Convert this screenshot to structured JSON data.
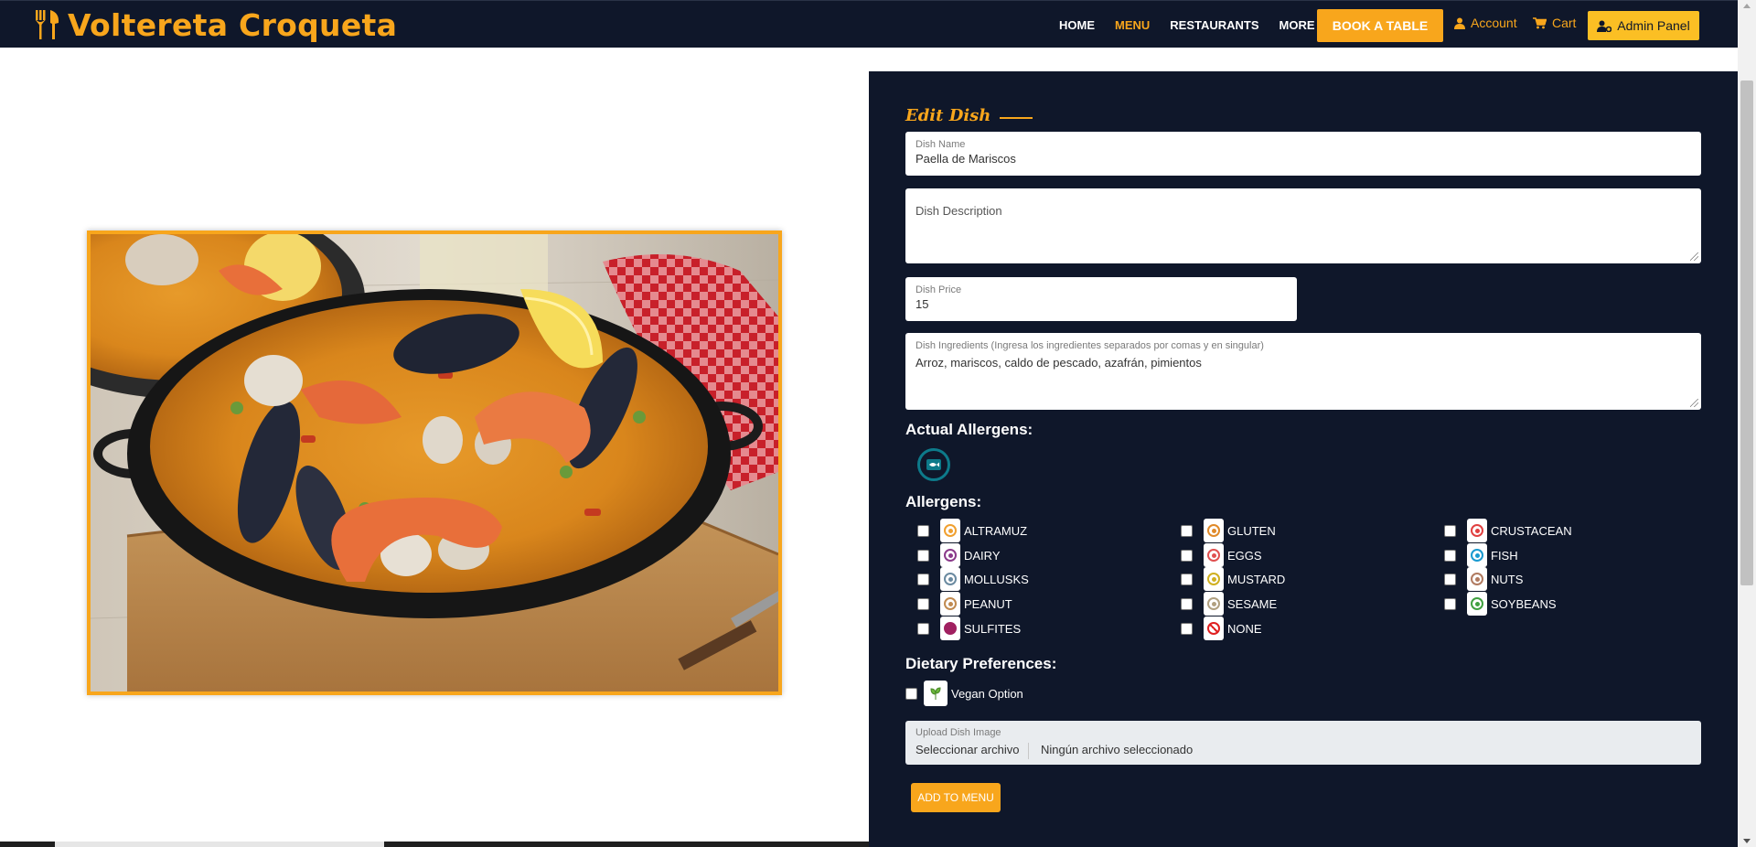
{
  "brand": {
    "name": "Voltereta Croqueta",
    "icon": "fork-knife-icon"
  },
  "nav": {
    "links": [
      {
        "label": "HOME",
        "active": false
      },
      {
        "label": "MENU",
        "active": true
      },
      {
        "label": "RESTAURANTS",
        "active": false
      },
      {
        "label": "MORE",
        "active": false
      }
    ],
    "book_label": "BOOK A TABLE",
    "account_label": "Account",
    "cart_label": "Cart",
    "admin_label": "Admin Panel"
  },
  "image": {
    "subject": "Seafood paella in a pan with mussels, prawns, clams and lemon"
  },
  "form": {
    "title": "Edit Dish",
    "dish_name": {
      "label": "Dish Name",
      "value": "Paella de Mariscos"
    },
    "dish_description": {
      "placeholder": "Dish Description"
    },
    "dish_price": {
      "label": "Dish Price",
      "value": "15"
    },
    "dish_ingredients": {
      "label": "Dish Ingredients (Ingresa los ingredientes separados por comas y en singular)",
      "value": "Arroz, mariscos, caldo de pescado, azafrán, pimientos"
    },
    "actual_allergens_title": "Actual Allergens:",
    "allergens_title": "Allergens:",
    "allergens": [
      {
        "label": "ALTRAMUZ",
        "color": "#f0a030",
        "checked": false
      },
      {
        "label": "GLUTEN",
        "color": "#e08a2a",
        "checked": false
      },
      {
        "label": "CRUSTACEAN",
        "color": "#e04040",
        "checked": false
      },
      {
        "label": "DAIRY",
        "color": "#8a3a8a",
        "checked": false
      },
      {
        "label": "EGGS",
        "color": "#e05050",
        "checked": false
      },
      {
        "label": "FISH",
        "color": "#1a9ad0",
        "checked": false
      },
      {
        "label": "MOLLUSKS",
        "color": "#6a8aa0",
        "checked": false
      },
      {
        "label": "MUSTARD",
        "color": "#d0b020",
        "checked": false
      },
      {
        "label": "NUTS",
        "color": "#b07a60",
        "checked": false
      },
      {
        "label": "PEANUT",
        "color": "#c08a50",
        "checked": false
      },
      {
        "label": "SESAME",
        "color": "#b0a080",
        "checked": false
      },
      {
        "label": "SOYBEANS",
        "color": "#40a040",
        "checked": false
      },
      {
        "label": "SULFITES",
        "color": "#a02060",
        "checked": false
      },
      {
        "label": "NONE",
        "color": "#e02020",
        "checked": false
      }
    ],
    "dietary_title": "Dietary Preferences:",
    "vegan_label": "Vegan Option",
    "upload": {
      "label": "Upload Dish Image",
      "button": "Seleccionar archivo",
      "status": "Ningún archivo seleccionado"
    },
    "submit_label": "ADD TO MENU"
  }
}
